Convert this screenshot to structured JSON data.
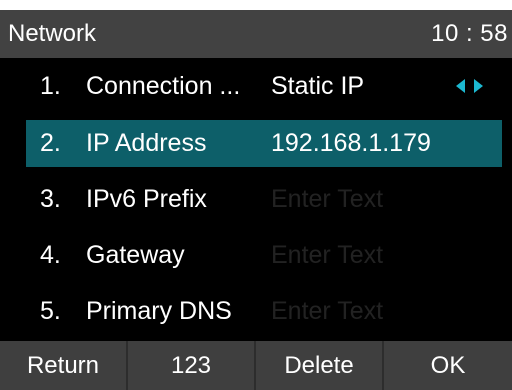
{
  "header": {
    "title": "Network",
    "time": "10 : 58"
  },
  "menu": {
    "items": [
      {
        "number": "1.",
        "label": "Connection ...",
        "value": "Static IP",
        "control": "left-right-arrows"
      },
      {
        "number": "2.",
        "label": "IP Address",
        "value": "192.168.1.179",
        "selected": true
      },
      {
        "number": "3.",
        "label": "IPv6 Prefix",
        "placeholder": "Enter Text"
      },
      {
        "number": "4.",
        "label": "Gateway",
        "placeholder": "Enter Text"
      },
      {
        "number": "5.",
        "label": "Primary  DNS",
        "placeholder": "Enter Text"
      }
    ]
  },
  "softkeys": {
    "return": "Return",
    "input_mode": "123",
    "delete": "Delete",
    "ok": "OK"
  },
  "colors": {
    "highlight": "#0d5f69",
    "arrow": "#1cb8d1",
    "header": "#424242",
    "softkey_bar": "#3f3f3f"
  }
}
